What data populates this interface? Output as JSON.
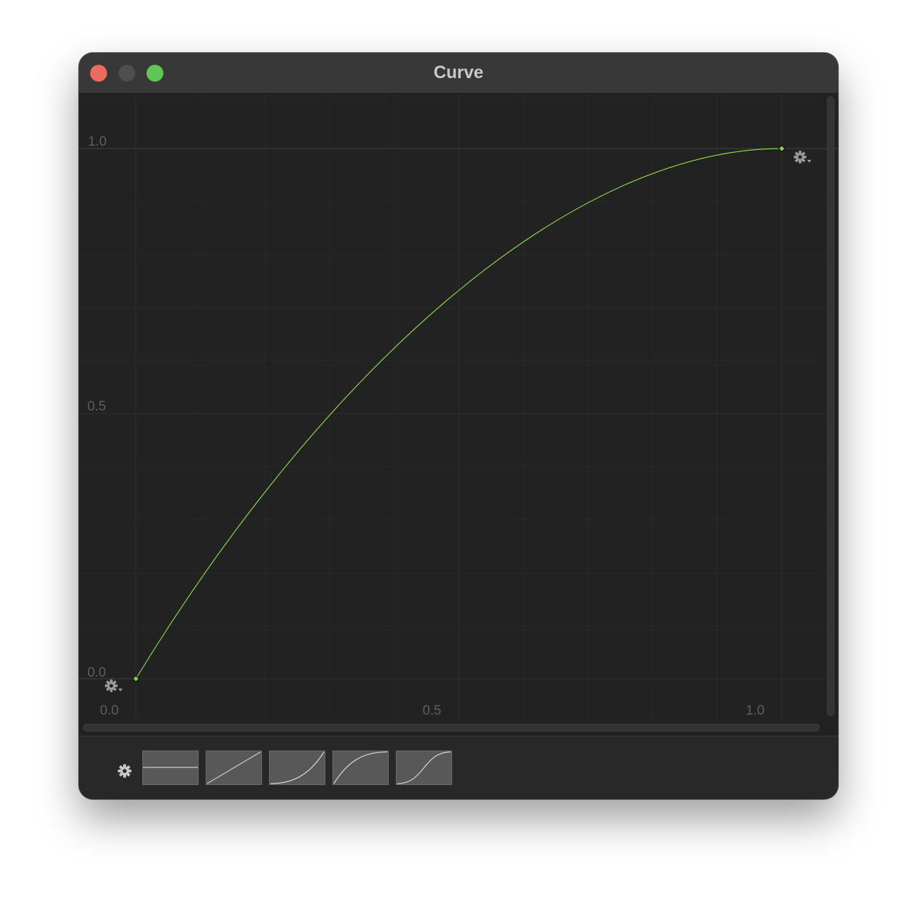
{
  "window": {
    "title": "Curve"
  },
  "graph": {
    "y_tick_labels": [
      "1.0",
      "0.5",
      "0.0"
    ],
    "x_tick_labels": [
      "0.0",
      "0.5",
      "1.0"
    ],
    "curve_color": "#8ad64a",
    "keyframes": [
      {
        "time": 0.0,
        "value": 0.0
      },
      {
        "time": 1.0,
        "value": 1.0
      }
    ]
  },
  "presets": [
    {
      "name": "constant"
    },
    {
      "name": "linear"
    },
    {
      "name": "ease-in"
    },
    {
      "name": "ease-out"
    },
    {
      "name": "ease-in-out"
    }
  ],
  "colors": {
    "background": "#222222",
    "window": "#282828",
    "titlebar": "#383838",
    "close": "#ec6a5e",
    "zoom": "#61c554"
  }
}
